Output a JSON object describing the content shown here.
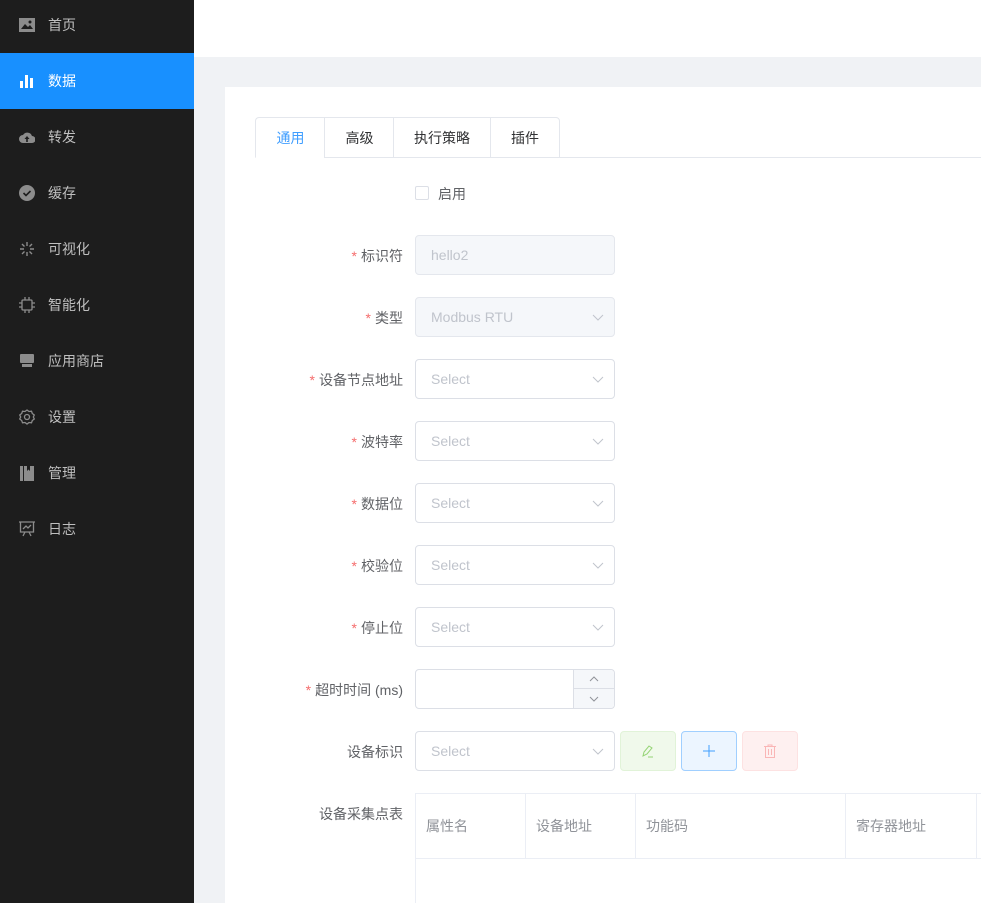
{
  "sidebar": {
    "items": [
      {
        "label": "首页",
        "icon": "image-icon"
      },
      {
        "label": "数据",
        "icon": "bar-chart-icon",
        "active": true
      },
      {
        "label": "转发",
        "icon": "cloud-upload-icon"
      },
      {
        "label": "缓存",
        "icon": "check-circle-icon"
      },
      {
        "label": "可视化",
        "icon": "loading-icon"
      },
      {
        "label": "智能化",
        "icon": "chip-icon"
      },
      {
        "label": "应用商店",
        "icon": "shop-icon"
      },
      {
        "label": "设置",
        "icon": "gear-icon"
      },
      {
        "label": "管理",
        "icon": "book-icon"
      },
      {
        "label": "日志",
        "icon": "presentation-chart-icon"
      }
    ]
  },
  "tabs": [
    "通用",
    "高级",
    "执行策略",
    "插件"
  ],
  "form": {
    "enable_label": "启用",
    "id_label": "标识符",
    "id_value": "hello2",
    "type_label": "类型",
    "type_value": "Modbus RTU",
    "node_label": "设备节点地址",
    "baud_label": "波特率",
    "databits_label": "数据位",
    "parity_label": "校验位",
    "stopbits_label": "停止位",
    "timeout_label": "超时时间 (ms)",
    "device_id_label": "设备标识",
    "points_label": "设备采集点表",
    "placeholder": "Select"
  },
  "table": {
    "columns": [
      "属性名",
      "设备地址",
      "功能码",
      "寄存器地址"
    ]
  },
  "colors": {
    "accent": "#1890ff",
    "sidebar": "#1d1d1d"
  }
}
